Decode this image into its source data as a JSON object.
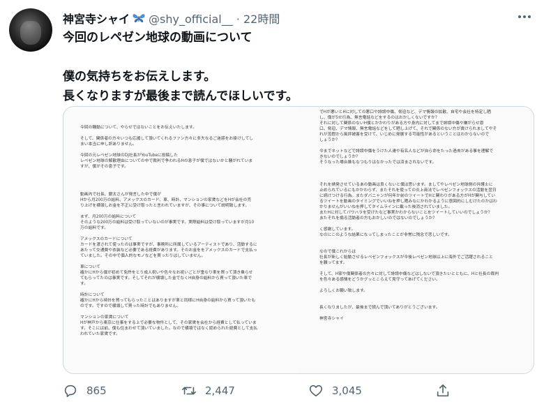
{
  "tweet": {
    "author_name": "神宮寺シャイ",
    "author_icon": "butterfly-icon",
    "handle_line": "@shy_official__ · 22時間",
    "more_icon": "more-icon",
    "lines": [
      "今回のレペゼン地球の動画について",
      "",
      "僕の気持ちをお伝えします。",
      "長くなりますが最後まで読んでほしいです。"
    ]
  },
  "letter": {
    "left_lines": [
      "今回の騒動について、やらせではないことをお伝えいたします。",
      "",
      "そして、関係者の方々いつも応援して頂いてくれるファン方々に多大なるご迷惑をお掛けしてし",
      "まい本当に申し訳ありません。",
      "",
      "今回の元レペゼン地球のDJ社長がYouTubeに投稿した",
      "レペゼン地球の解散理由についての中で裁判で争われるHの息子が僕ではないかと騒がれていま",
      "すが、僕がその息子です。",
      "",
      "",
      "",
      "",
      "動画内で社長、銀太さんが発言した中で僕が",
      "Hから月200万の給料、アメックスのカード、車、時計、マンションの家賃などをHが会社の売",
      "り上げを横領しお金を不正に受け取ったと言われていますが、その事について説明致します。",
      "",
      "まず、月200万の給料について",
      "そのような200万の給料は受け取っていないのが事実です。実際給料は受け取っていますが月10",
      "万の給料です。",
      "",
      "アメックスのカードについて",
      "カードを渡されて使ったのは事実ですが、事務所に所属しているアーティストであり、活動するに",
      "あたって交通費や衣装など必要である経費があります。そのお金ををアメックスのカードで支払っ",
      "ていました。その中で個人的なモノなどを買ったりはしていません。",
      "",
      "車について",
      "確かにHから僕が初めて免許をとり成人祝いや色々なお祝いごとが重なり車を買って頂き乗らせ",
      "てもらってたのは事実です。そしてそれが横領した金でなくH自身の給料から買って頂いた車で",
      "す。",
      "",
      "時計について",
      "確かにHから時計を買ってもらったことはありますが車と同様にH自身の給料から買って頂いたも",
      "のです。ですので横領して買った時計でもありません。",
      "",
      "マンションの家賃について",
      "Hが神戸から東京に仕事をする上で必要な物件として、その家賃を会社から経費として払っていま",
      "す。そこには前、僕も住まわせて頂いていました。なので横領ではなく認められた経費として支払",
      "われていた家賃です。"
    ],
    "right_lines": [
      "でHが悪いとHに対しての悪口や誹謗中傷、脅迫など、デマ情報の拡散、自宅や会社を特定し晒",
      "し、僕が5せ行為、無言電話などをするのはおかしくないですか？",
      "それに対して関係のないH僕とかかわりがある方や身内に対してまで誹謗中傷や嫌がらせ恩",
      "口、脅迫、デマ情報、無言電話などをして晒し上げて、それで関係のない方が責けられましてやそ",
      "れが苦悶から風評被害を受けて、いじめに発展する可能性があるということはわからないので",
      "しょうか？",
      "",
      "今までネットなどで誹謗中傷をうけた人達や有名人などが自ら命をたった過去がある事を理解で",
      "きないのでしょうか？",
      "そうなった場合誰もなつもりはなかったでは済まされないです。",
      "",
      "",
      "",
      "それを誘発させているあの動画は良くないと僕は思います。ましてやレペゼン地球側の弁護士に",
      "止められているにもかかわらず、またそれを使っての炎上商法でレペゼンフォックスの活動を翌日",
      "に続けつける行為。またダバニャンが何年か前のツイートでHと関わりがある方がHが関与してい",
      "るツイートを動画のタイミングでいいねを押し晒みなにかわかるように意図的にしむけたのかはわ",
      "かりませんがいいねを押してタイムラインに載った後消されていました。",
      "またHに対してパワハラを受けたなど事実かわからないことをツイートしていいのでしょうか？",
      "またそれを煽る活動者の方もおかしいのではないのでしょうか？",
      "",
      "く感謝しています。",
      "なのにこのような結果になってしまったことが非常に残念で悲しいです。",
      "",
      "",
      "なので僕これからは",
      "社長が新しく始動させるレペゼンフォックスが今後レペゼン地球以上に海外でご活躍されること",
      "を願ってます。",
      "",
      "そして、H家や僕関係者の方々に対して誹謗中傷などはしないで頂きたいとともに、Hと社長の裁判",
      "を色々ある感情をどうかグッとこらえて見守ってあげてください。",
      "",
      "よろしくお願い致します。",
      "",
      "",
      "長くなりましたが、最後まで読んで頂いてありがとうございます。",
      "",
      "神宮寺シャイ"
    ]
  },
  "actions": {
    "reply": {
      "icon": "reply-icon",
      "count": "865"
    },
    "retweet": {
      "icon": "retweet-icon",
      "count": "2,447"
    },
    "like": {
      "icon": "heart-icon",
      "count": "3,045"
    },
    "share": {
      "icon": "share-icon"
    }
  },
  "colors": {
    "text_primary": "#0f1419",
    "text_secondary": "#536471",
    "border": "#cfd9de",
    "butterfly": "#4a90d9"
  }
}
